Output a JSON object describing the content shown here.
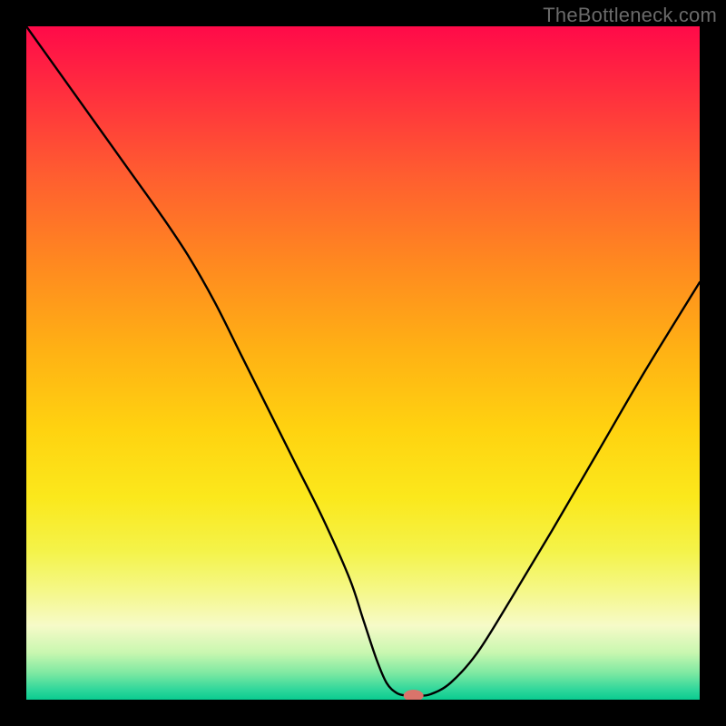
{
  "watermark": {
    "text": "TheBottleneck.com"
  },
  "chart_data": {
    "type": "line",
    "title": "",
    "xlabel": "",
    "ylabel": "",
    "xlim": [
      0,
      100
    ],
    "ylim": [
      0,
      100
    ],
    "grid": false,
    "legend": false,
    "series": [
      {
        "name": "bottleneck-curve",
        "x": [
          0,
          5,
          10,
          15,
          20,
          24,
          28,
          32,
          36,
          40,
          44,
          48,
          50,
          52,
          53.5,
          55,
          56.5,
          58,
          60,
          63,
          67,
          72,
          78,
          85,
          92,
          100
        ],
        "y": [
          100,
          93,
          86,
          79,
          72,
          66,
          59,
          51,
          43,
          35,
          27,
          18,
          12,
          6,
          2.5,
          1,
          0.6,
          0.6,
          0.8,
          2.5,
          7,
          15,
          25,
          37,
          49,
          62
        ]
      }
    ],
    "marker": {
      "name": "optimal-point",
      "x": 57.5,
      "y": 0.6,
      "color": "#d9746b",
      "rx": 11,
      "ry": 6.5
    },
    "background": {
      "type": "vertical-gradient",
      "stops": [
        {
          "pos": 0.0,
          "color": "#ff0a49"
        },
        {
          "pos": 0.5,
          "color": "#ffc312"
        },
        {
          "pos": 0.8,
          "color": "#f4f34a"
        },
        {
          "pos": 1.0,
          "color": "#0acb90"
        }
      ]
    }
  }
}
